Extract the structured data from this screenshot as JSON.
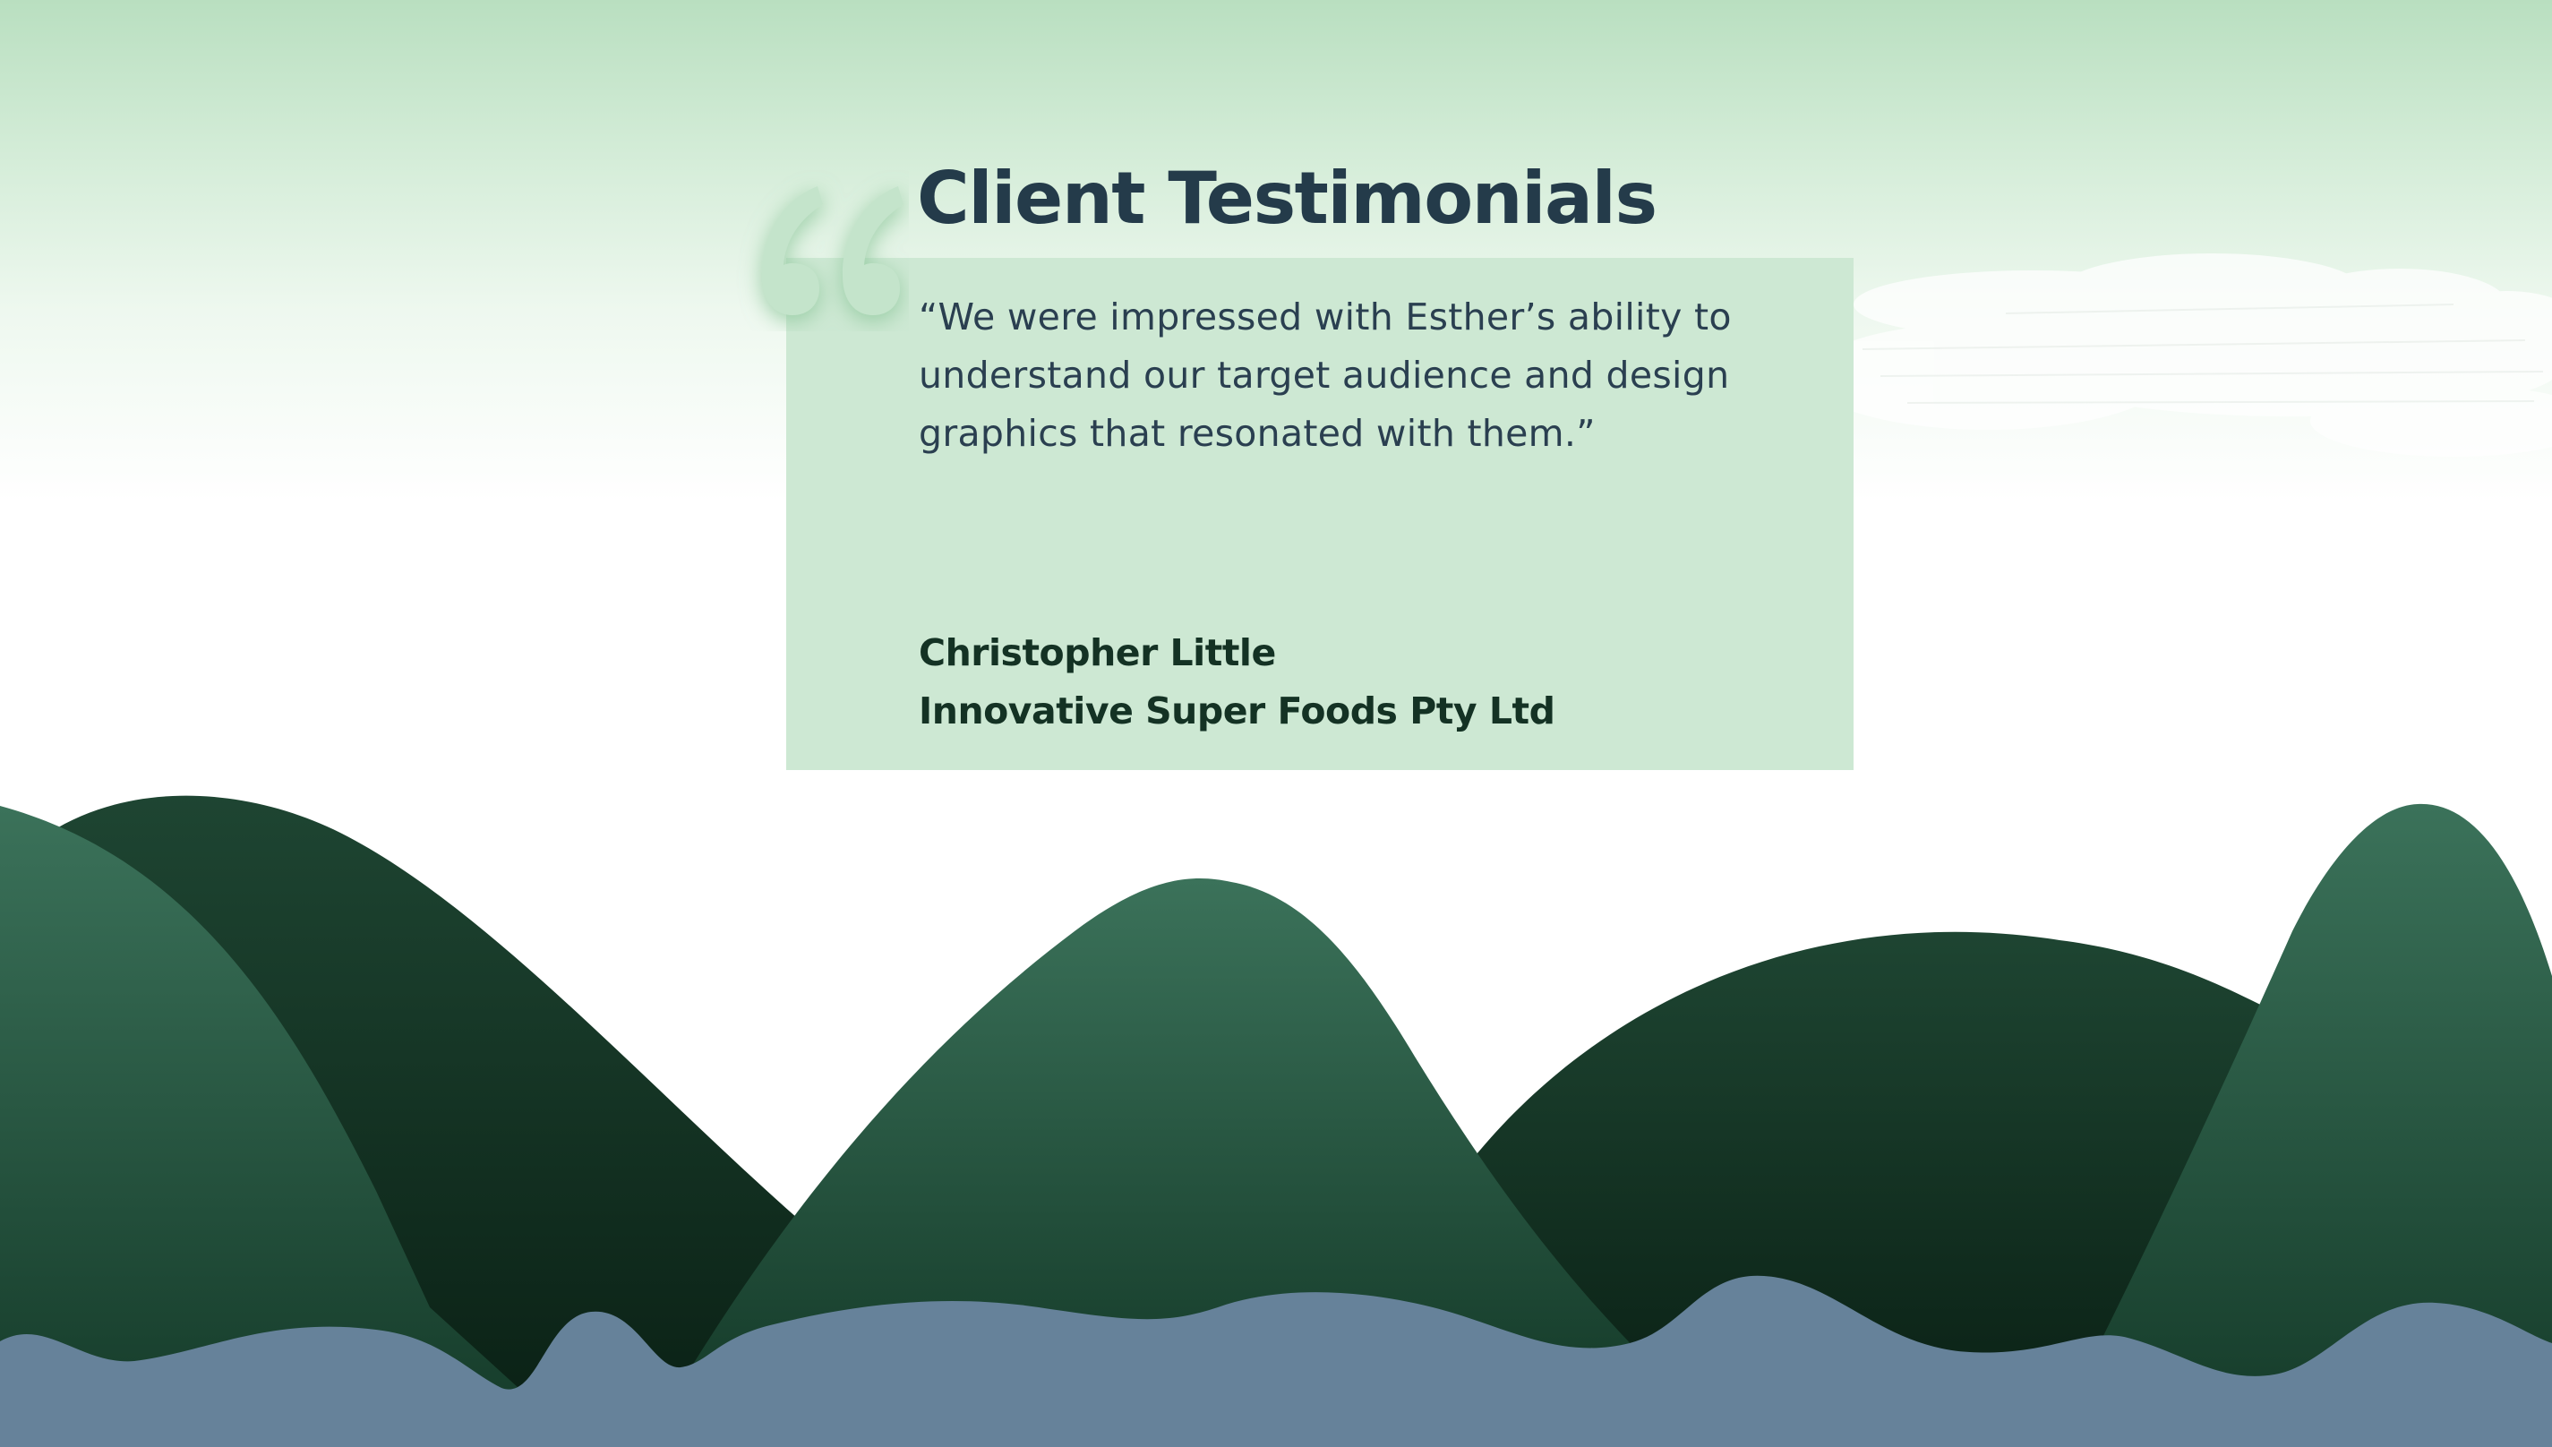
{
  "slide": {
    "title": "Client Testimonials",
    "quote": "“We were impressed with Esther’s ability to understand our target audience and design graphics that resonated with them.”",
    "author_name": "Christopher Little",
    "author_company": "Innovative Super Foods Pty Ltd"
  },
  "colors": {
    "sky_top": "#b9dfc0",
    "card": "#cde8d3",
    "title_text": "#243b4a",
    "body_text": "#2a3f50",
    "author_text": "#143224",
    "hill_light": "#376b55",
    "hill_dark": "#173c2b",
    "water": "#66829a"
  },
  "icons": {
    "quote_mark": "quote-mark-icon"
  }
}
